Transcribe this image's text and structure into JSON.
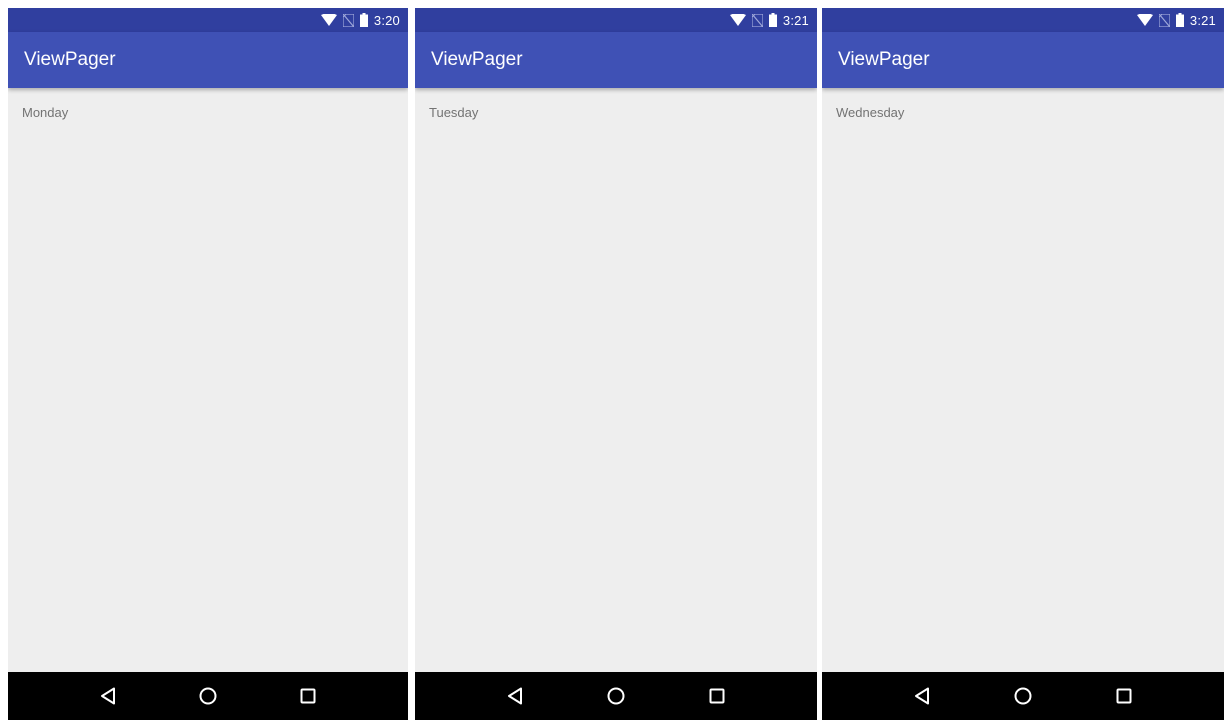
{
  "colors": {
    "status_bar": "#303f9f",
    "app_bar": "#3f51b5",
    "background": "#eeeeee",
    "nav_bar": "#000000",
    "label_text": "#737373"
  },
  "screens": [
    {
      "status": {
        "time": "3:20",
        "icons": [
          "wifi-icon",
          "no-sim-icon",
          "battery-icon"
        ]
      },
      "app_bar": {
        "title": "ViewPager"
      },
      "page": {
        "label": "Monday"
      },
      "nav": [
        "back-icon",
        "home-icon",
        "recents-icon"
      ]
    },
    {
      "status": {
        "time": "3:21",
        "icons": [
          "wifi-icon",
          "no-sim-icon",
          "battery-icon"
        ]
      },
      "app_bar": {
        "title": "ViewPager"
      },
      "page": {
        "label": "Tuesday"
      },
      "nav": [
        "back-icon",
        "home-icon",
        "recents-icon"
      ]
    },
    {
      "status": {
        "time": "3:21",
        "icons": [
          "wifi-icon",
          "no-sim-icon",
          "battery-icon"
        ]
      },
      "app_bar": {
        "title": "ViewPager"
      },
      "page": {
        "label": "Wednesday"
      },
      "nav": [
        "back-icon",
        "home-icon",
        "recents-icon"
      ]
    }
  ]
}
